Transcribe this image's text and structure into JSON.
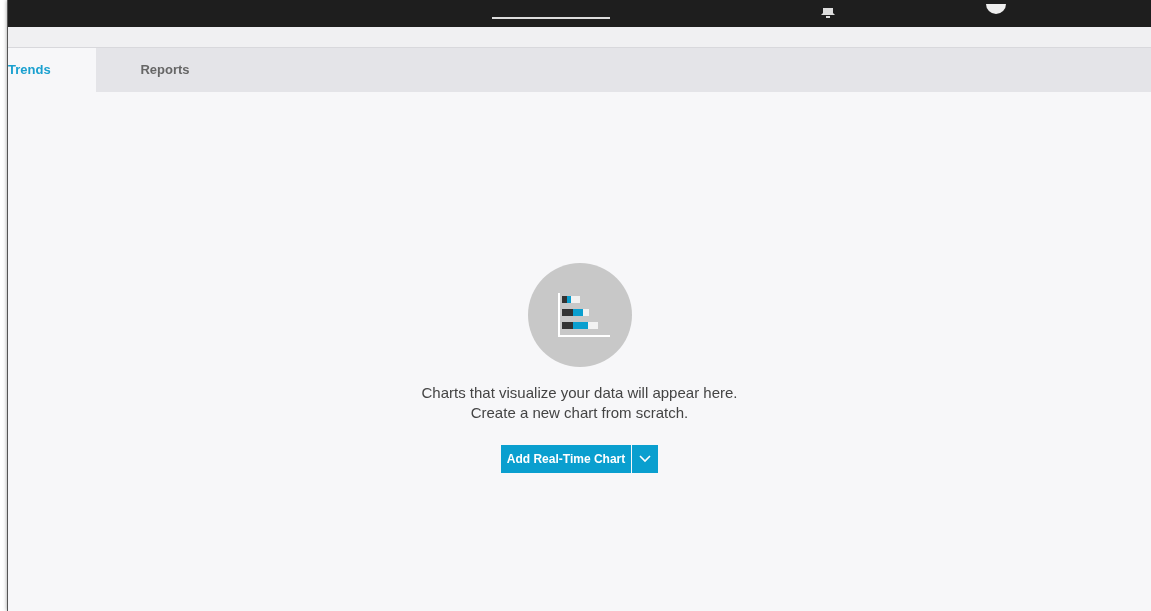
{
  "tabs": [
    {
      "label": "Trends",
      "selected": true
    },
    {
      "label": "Reports",
      "selected": false
    }
  ],
  "empty_state": {
    "message": "Charts that visualize your data will appear here.",
    "hint": "Create a new chart from scratch.",
    "button": "Add Real-Time Chart"
  }
}
